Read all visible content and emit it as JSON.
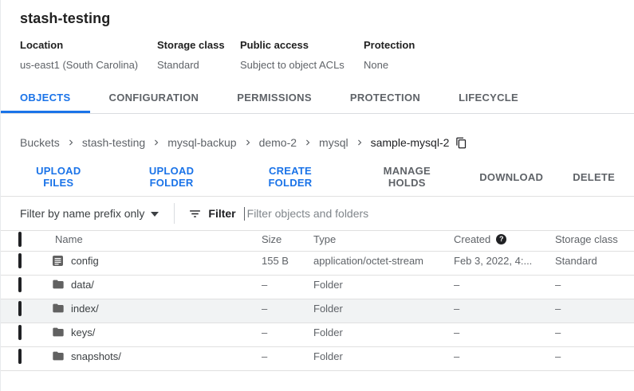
{
  "header": {
    "title": "stash-testing",
    "meta": [
      {
        "label": "Location",
        "value": "us-east1 (South Carolina)"
      },
      {
        "label": "Storage class",
        "value": "Standard"
      },
      {
        "label": "Public access",
        "value": "Subject to object ACLs"
      },
      {
        "label": "Protection",
        "value": "None"
      }
    ]
  },
  "tabs": [
    {
      "label": "OBJECTS",
      "active": true
    },
    {
      "label": "CONFIGURATION",
      "active": false
    },
    {
      "label": "PERMISSIONS",
      "active": false
    },
    {
      "label": "PROTECTION",
      "active": false
    },
    {
      "label": "LIFECYCLE",
      "active": false
    }
  ],
  "breadcrumb": {
    "items": [
      "Buckets",
      "stash-testing",
      "mysql-backup",
      "demo-2",
      "mysql",
      "sample-mysql-2"
    ],
    "copy_icon": "content-copy-icon"
  },
  "actions": [
    {
      "label": "UPLOAD FILES",
      "enabled": true
    },
    {
      "label": "UPLOAD FOLDER",
      "enabled": true
    },
    {
      "label": "CREATE FOLDER",
      "enabled": true
    },
    {
      "label": "MANAGE HOLDS",
      "enabled": false
    },
    {
      "label": "DOWNLOAD",
      "enabled": false
    },
    {
      "label": "DELETE",
      "enabled": false
    }
  ],
  "filter_bar": {
    "scope_label": "Filter by name prefix only",
    "scope_caret_icon": "dropdown-caret-icon",
    "filter_icon": "filter-list-icon",
    "filter_label": "Filter",
    "input_value": "",
    "input_placeholder": "Filter objects and folders"
  },
  "table": {
    "columns": {
      "name": "Name",
      "size": "Size",
      "type": "Type",
      "created": "Created",
      "storage": "Storage class"
    },
    "created_help_icon": "help-icon",
    "rows": [
      {
        "icon": "file-icon",
        "name": "config",
        "size": "155 B",
        "type": "application/octet-stream",
        "created": "Feb 3, 2022, 4:...",
        "storage": "Standard",
        "checked": false,
        "highlighted": false
      },
      {
        "icon": "folder-icon",
        "name": "data/",
        "size": "–",
        "type": "Folder",
        "created": "–",
        "storage": "–",
        "checked": false,
        "highlighted": false
      },
      {
        "icon": "folder-icon",
        "name": "index/",
        "size": "–",
        "type": "Folder",
        "created": "–",
        "storage": "–",
        "checked": false,
        "highlighted": true
      },
      {
        "icon": "folder-icon",
        "name": "keys/",
        "size": "–",
        "type": "Folder",
        "created": "–",
        "storage": "–",
        "checked": false,
        "highlighted": false
      },
      {
        "icon": "folder-icon",
        "name": "snapshots/",
        "size": "–",
        "type": "Folder",
        "created": "–",
        "storage": "–",
        "checked": false,
        "highlighted": false
      }
    ]
  },
  "colors": {
    "accent_blue": "#1a73e8",
    "text_dark": "#202124",
    "text_muted": "#5f6368",
    "border": "#e0e0e0",
    "row_hover_bg": "#f1f3f4",
    "icon_gray": "#616161"
  }
}
